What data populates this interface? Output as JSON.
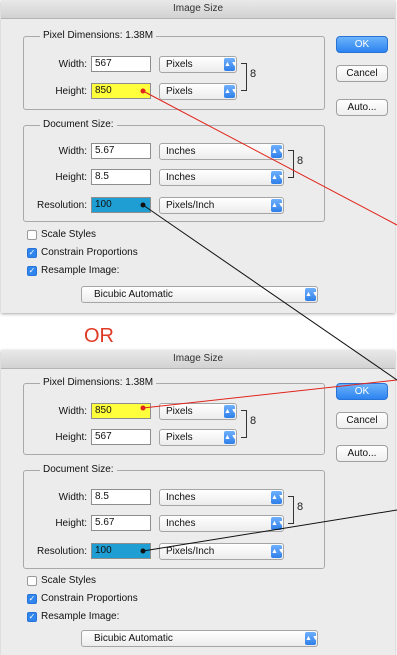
{
  "dialog_title": "Image Size",
  "separator_text": "OR",
  "dialogs": [
    {
      "pixel_dimensions_label": "Pixel Dimensions:",
      "pixel_dimensions_size": "1.38M",
      "width_label": "Width:",
      "width_value": "567",
      "width_unit": "Pixels",
      "height_label": "Height:",
      "height_value": "850",
      "height_unit": "Pixels",
      "document_size_label": "Document Size:",
      "doc_width_label": "Width:",
      "doc_width_value": "5.67",
      "doc_width_unit": "Inches",
      "doc_height_label": "Height:",
      "doc_height_value": "8.5",
      "doc_height_unit": "Inches",
      "resolution_label": "Resolution:",
      "resolution_value": "100",
      "resolution_unit": "Pixels/Inch",
      "scale_styles_label": "Scale Styles",
      "constrain_label": "Constrain Proportions",
      "resample_label": "Resample Image:",
      "resample_method": "Bicubic Automatic",
      "ok_label": "OK",
      "cancel_label": "Cancel",
      "auto_label": "Auto..."
    },
    {
      "pixel_dimensions_label": "Pixel Dimensions:",
      "pixel_dimensions_size": "1.38M",
      "width_label": "Width:",
      "width_value": "850",
      "width_unit": "Pixels",
      "height_label": "Height:",
      "height_value": "567",
      "height_unit": "Pixels",
      "document_size_label": "Document Size:",
      "doc_width_label": "Width:",
      "doc_width_value": "8.5",
      "doc_width_unit": "Inches",
      "doc_height_label": "Height:",
      "doc_height_value": "5.67",
      "doc_height_unit": "Inches",
      "resolution_label": "Resolution:",
      "resolution_value": "100",
      "resolution_unit": "Pixels/Inch",
      "scale_styles_label": "Scale Styles",
      "constrain_label": "Constrain Proportions",
      "resample_label": "Resample Image:",
      "resample_method": "Bicubic Automatic",
      "ok_label": "OK",
      "cancel_label": "Cancel",
      "auto_label": "Auto..."
    }
  ],
  "colors": {
    "highlight_yellow": "#ffff3b",
    "highlight_blue": "#1e9ed3",
    "callout_red": "#e0241b",
    "callout_black": "#111111",
    "separator_orange": "#e03a25"
  },
  "icons": [
    "link-chain-icon",
    "dropdown-arrows-icon",
    "checkmark-icon"
  ]
}
